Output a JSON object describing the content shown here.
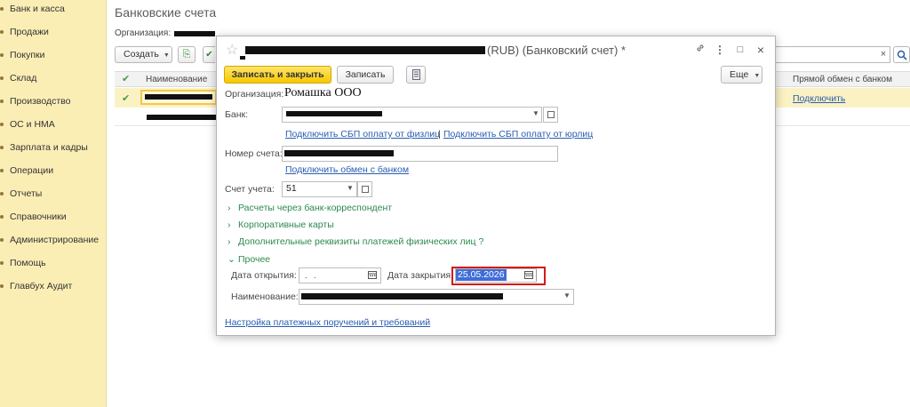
{
  "sidebar": {
    "items": [
      {
        "label": "Банк и касса"
      },
      {
        "label": "Продажи"
      },
      {
        "label": "Покупки"
      },
      {
        "label": "Склад"
      },
      {
        "label": "Производство"
      },
      {
        "label": "ОС и НМА"
      },
      {
        "label": "Зарплата и кадры"
      },
      {
        "label": "Операции"
      },
      {
        "label": "Отчеты"
      },
      {
        "label": "Справочники"
      },
      {
        "label": "Администрирование"
      },
      {
        "label": "Помощь"
      },
      {
        "label": "Главбух Аудит"
      }
    ]
  },
  "list_page": {
    "title": "Банковские счета",
    "org_label": "Организация:",
    "create_label": "Создать",
    "columns": {
      "name": "Наименование",
      "direct_exchange": "Прямой обмен с банком"
    },
    "row_link": "Подключить",
    "search_clear": "×"
  },
  "modal": {
    "title_suffix": "(RUB) (Банковский счет) *",
    "toolbar": {
      "save_close": "Записать и закрыть",
      "save": "Записать",
      "more": "Еще"
    },
    "org_label": "Организация:",
    "org_value": "Ромашка ООО",
    "bank_label": "Банк:",
    "sbp_individual_link": "Подключить СБП оплату от физлиц",
    "link_separator": "|",
    "sbp_legal_link": "Подключить СБП оплату от юрлиц",
    "account_number_label": "Номер счета:",
    "bank_exchange_link": "Подключить обмен с банком",
    "ledger_account_label": "Счет учета:",
    "ledger_account_value": "51",
    "groups": {
      "correspondent": "Расчеты через банк-корреспондент",
      "corporate_cards": "Корпоративные карты",
      "extra_details": "Дополнительные реквизиты платежей физических лиц",
      "extra_details_help": "?",
      "other": "Прочее"
    },
    "open_date_label": "Дата открытия:",
    "open_date_value": ". .",
    "close_date_label": "Дата закрытия:",
    "close_date_value": "25.05.2026",
    "name_label": "Наименование:",
    "payment_settings_link": "Настройка платежных поручений и требований"
  }
}
